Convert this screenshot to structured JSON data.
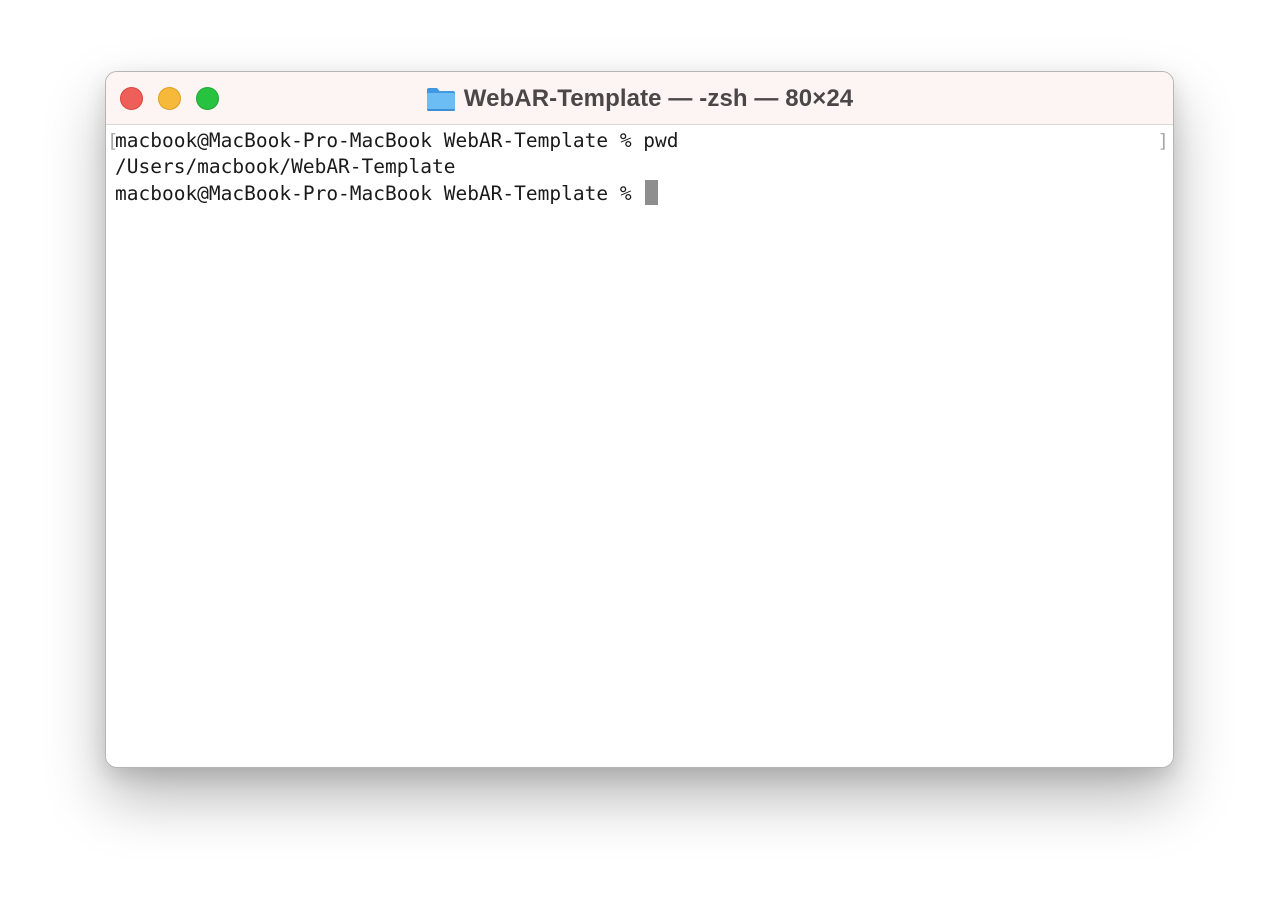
{
  "window": {
    "title": "WebAR-Template — -zsh — 80×24",
    "folder_icon": "folder-icon",
    "colors": {
      "close": "#ed5f58",
      "minimize": "#f6b93a",
      "zoom": "#27c23f",
      "titlebar": "#fcf5f4",
      "folder": "#4aa3e8"
    }
  },
  "terminal": {
    "left_marker": "[",
    "right_marker": "]",
    "lines": [
      "macbook@MacBook-Pro-MacBook WebAR-Template % pwd",
      "/Users/macbook/WebAR-Template",
      "macbook@MacBook-Pro-MacBook WebAR-Template % "
    ]
  }
}
